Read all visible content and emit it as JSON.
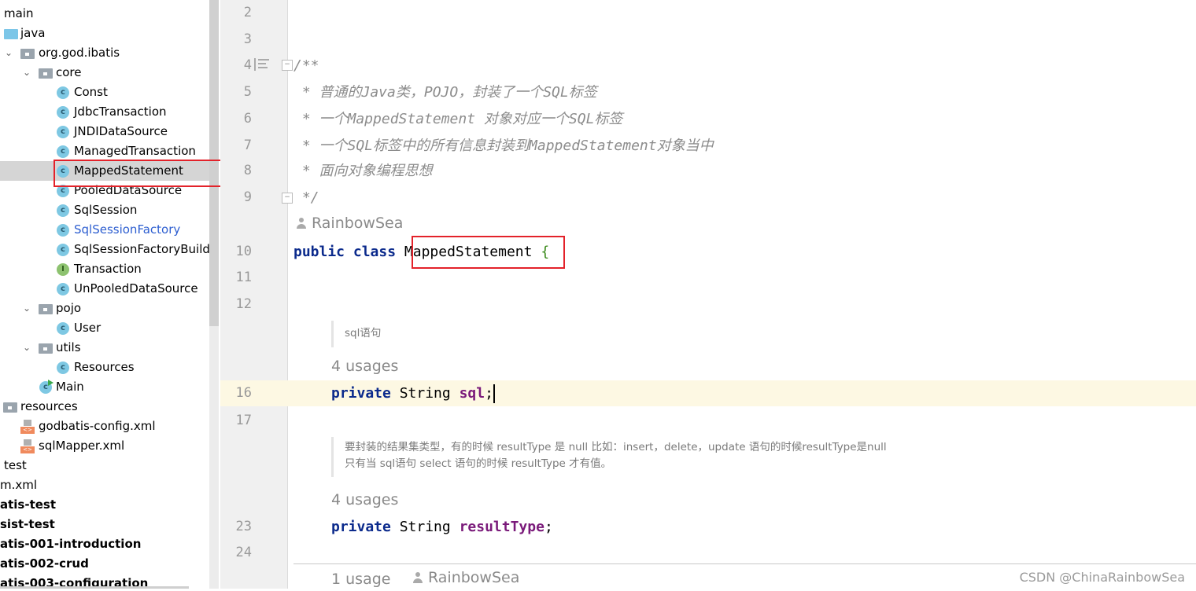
{
  "project_tree": {
    "items": [
      {
        "label": "main",
        "indent": 0,
        "icon": "none"
      },
      {
        "label": "java",
        "icon": "folder-source-icon"
      },
      {
        "label": "org.god.ibatis",
        "icon": "package-icon",
        "expanded": true
      },
      {
        "label": "core",
        "icon": "package-icon",
        "expanded": true
      },
      {
        "label": "Const",
        "icon": "class-icon"
      },
      {
        "label": "JdbcTransaction",
        "icon": "class-icon"
      },
      {
        "label": "JNDIDataSource",
        "icon": "class-icon"
      },
      {
        "label": "ManagedTransaction",
        "icon": "class-icon"
      },
      {
        "label": "MappedStatement",
        "icon": "class-icon",
        "selected": true
      },
      {
        "label": "PooledDataSource",
        "icon": "class-icon"
      },
      {
        "label": "SqlSession",
        "icon": "class-icon"
      },
      {
        "label": "SqlSessionFactory",
        "icon": "class-icon",
        "modified": true
      },
      {
        "label": "SqlSessionFactoryBuilder",
        "icon": "class-icon"
      },
      {
        "label": "Transaction",
        "icon": "interface-icon"
      },
      {
        "label": "UnPooledDataSource",
        "icon": "class-icon"
      },
      {
        "label": "pojo",
        "icon": "package-icon",
        "expanded": true
      },
      {
        "label": "User",
        "icon": "class-icon"
      },
      {
        "label": "utils",
        "icon": "package-icon",
        "expanded": true
      },
      {
        "label": "Resources",
        "icon": "class-icon"
      },
      {
        "label": "Main",
        "icon": "runnable-class-icon"
      },
      {
        "label": "resources",
        "icon": "resources-folder-icon"
      },
      {
        "label": "godbatis-config.xml",
        "icon": "xml-file-icon"
      },
      {
        "label": "sqlMapper.xml",
        "icon": "xml-file-icon"
      },
      {
        "label": "test",
        "icon": "none"
      },
      {
        "label": "m.xml",
        "icon": "none"
      },
      {
        "label": "atis-test",
        "icon": "none",
        "bold": true
      },
      {
        "label": "sist-test",
        "icon": "none",
        "bold": true
      },
      {
        "label": "atis-001-introduction",
        "icon": "none",
        "bold": true
      },
      {
        "label": "atis-002-crud",
        "icon": "none",
        "bold": true
      },
      {
        "label": "atis-003-configuration",
        "icon": "none",
        "bold": true
      }
    ]
  },
  "editor": {
    "line_numbers": {
      "l2": "2",
      "l3": "3",
      "l4": "4",
      "l5": "5",
      "l6": "6",
      "l7": "7",
      "l8": "8",
      "l9": "9",
      "l10": "10",
      "l11": "11",
      "l12": "12",
      "l16": "16",
      "l17": "17",
      "l23": "23",
      "l24": "24"
    },
    "javadoc": {
      "open": "/**",
      "line1": " * 普通的Java类，POJO，封装了一个SQL标签",
      "line2": " * 一个MappedStatement 对象对应一个SQL标签",
      "line3": " * 一个SQL标签中的所有信息封装到MappedStatement对象当中",
      "line4": " * 面向对象编程思想",
      "close": " */"
    },
    "class_author": "RainbowSea",
    "class_decl": {
      "kw1": "public",
      "kw2": "class",
      "name": "MappedStatement",
      "brace": "{"
    },
    "field1": {
      "doc": "sql语句",
      "usages": "4 usages",
      "kw": "private",
      "type": "String",
      "name": "sql",
      "semi": ";"
    },
    "field2": {
      "doc_line1": "要封装的结果集类型，有的时候 resultType 是 null 比如：insert，delete，update 语句的时候resultType是null",
      "doc_line2": "只有当 sql语句 select 语句的时候 resultType 才有值。",
      "usages": "4 usages",
      "kw": "private",
      "type": "String",
      "name": "resultType",
      "semi": ";"
    },
    "next_member": {
      "usages": "1 usage",
      "author": "RainbowSea"
    }
  },
  "watermark": "CSDN @ChinaRainbowSea",
  "colors": {
    "highlight_box": "#e3222a",
    "current_line": "#fdf8e3",
    "keyword": "#0b2a8c",
    "field": "#7a1a7a"
  }
}
